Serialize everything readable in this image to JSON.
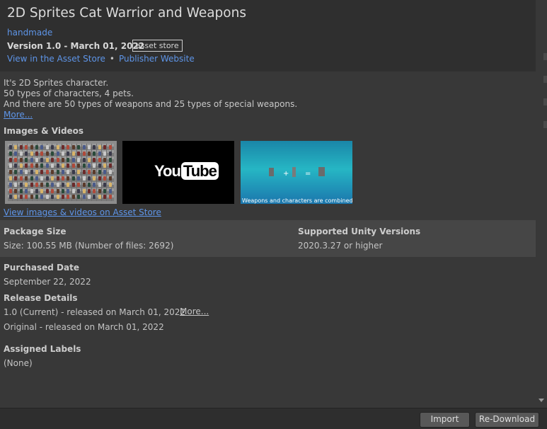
{
  "package": {
    "title": "2D Sprites Cat Warrior and Weapons",
    "author": "handmade",
    "version": "Version 1.0 - March 01, 2022",
    "badge": "asset store",
    "link_asset_store": "View in the Asset Store",
    "separator": "•",
    "link_publisher": "Publisher Website"
  },
  "description": {
    "line1": "It's 2D Sprites character.",
    "line2": "50 types of characters, 4 pets.",
    "line3": "And there are 50 types of weapons and 25 types of special weapons.",
    "more": "More..."
  },
  "media": {
    "heading": "Images & Videos",
    "video_logo_you": "You",
    "video_logo_tube": "Tube",
    "caption3": "Weapons and characters are combined",
    "view_link": "View images & videos on Asset Store"
  },
  "info": {
    "package_size_label": "Package Size",
    "package_size_value": "Size: 100.55 MB (Number of files: 2692)",
    "unity_versions_label": "Supported Unity Versions",
    "unity_versions_value": "2020.3.27 or higher"
  },
  "purchased": {
    "label": "Purchased Date",
    "value": "September 22, 2022"
  },
  "release": {
    "label": "Release Details",
    "current": "1.0 (Current) - released on March 01, 2022",
    "more": "More...",
    "original": "Original - released on March 01, 2022"
  },
  "labels": {
    "label": "Assigned Labels",
    "value": "(None)"
  },
  "footer": {
    "import": "Import",
    "redownload": "Re-Download"
  },
  "colors": {
    "link": "#5e95e8",
    "background": "#383838",
    "header_bg": "#2f2f2f"
  }
}
